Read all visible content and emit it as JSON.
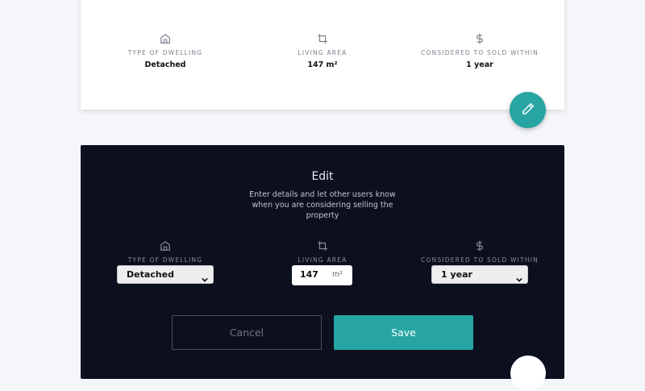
{
  "summary": {
    "type_of_dwelling": {
      "label": "TYPE OF DWELLING",
      "value": "Detached",
      "icon": "house-icon"
    },
    "living_area": {
      "label": "LIVING AREA",
      "value": "147 m²",
      "icon": "crop-icon"
    },
    "sold_within": {
      "label": "CONSIDERED TO SOLD WITHIN",
      "value": "1 year",
      "icon": "dollar-icon"
    }
  },
  "edit_fab_icon": "pencil-icon",
  "edit": {
    "title": "Edit",
    "description": "Enter details and let other users know when you are considering selling the property",
    "type_of_dwelling": {
      "label": "TYPE OF DWELLING",
      "selected": "Detached"
    },
    "living_area": {
      "label": "LIVING AREA",
      "value": "147",
      "unit": "m²"
    },
    "sold_within": {
      "label": "CONSIDERED TO SOLD WITHIN",
      "selected": "1 year"
    },
    "cancel_label": "Cancel",
    "save_label": "Save"
  },
  "colors": {
    "accent": "#26a5a2",
    "panel_bg": "#0b0f1e",
    "page_bg": "#f5f6fa"
  }
}
